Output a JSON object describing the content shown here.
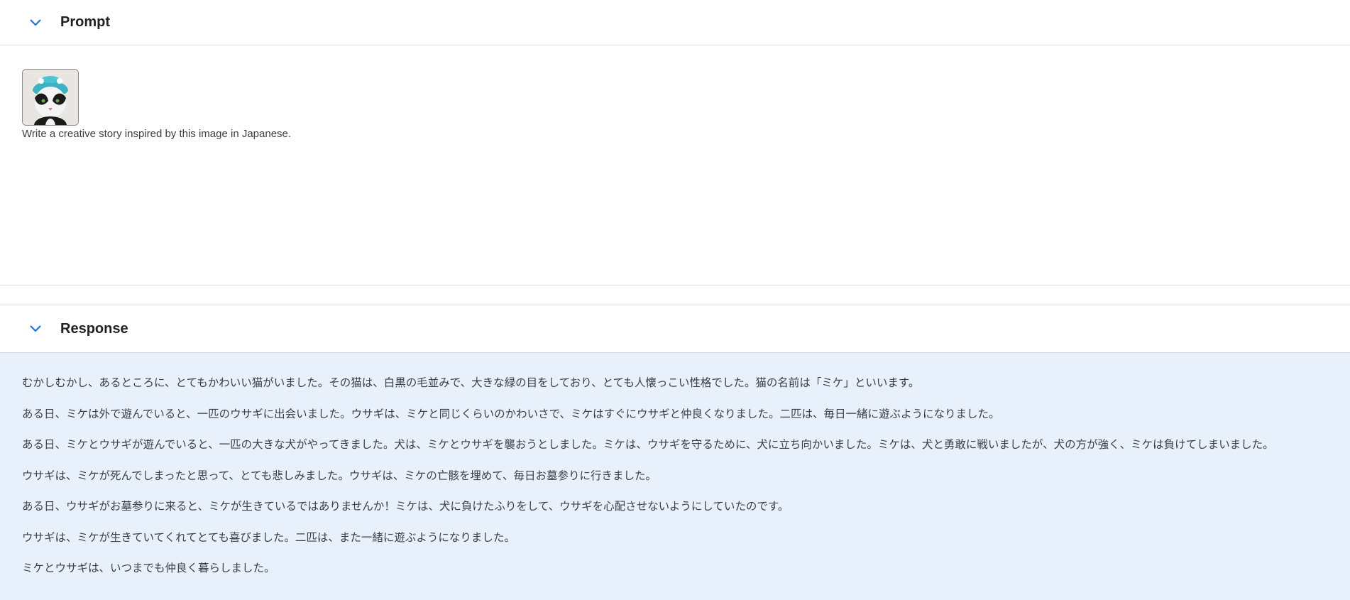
{
  "prompt_panel": {
    "title": "Prompt",
    "text": "Write a creative story inspired by this image in Japanese."
  },
  "response_panel": {
    "title": "Response",
    "paragraphs": [
      "むかしむかし、あるところに、とてもかわいい猫がいました。その猫は、白黒の毛並みで、大きな緑の目をしており、とても人懐っこい性格でした。猫の名前は「ミケ」といいます。",
      "ある日、ミケは外で遊んでいると、一匹のウサギに出会いました。ウサギは、ミケと同じくらいのかわいさで、ミケはすぐにウサギと仲良くなりました。二匹は、毎日一緒に遊ぶようになりました。",
      "ある日、ミケとウサギが遊んでいると、一匹の大きな犬がやってきました。犬は、ミケとウサギを襲おうとしました。ミケは、ウサギを守るために、犬に立ち向かいました。ミケは、犬と勇敢に戦いましたが、犬の方が強く、ミケは負けてしまいました。",
      "ウサギは、ミケが死んでしまったと思って、とても悲しみました。ウサギは、ミケの亡骸を埋めて、毎日お墓参りに行きました。",
      "ある日、ウサギがお墓参りに来ると、ミケが生きているではありませんか！ミケは、犬に負けたふりをして、ウサギを心配させないようにしていたのです。",
      "ウサギは、ミケが生きていてくれてとても喜びました。二匹は、また一緒に遊ぶようになりました。",
      "ミケとウサギは、いつまでも仲良く暮らしました。"
    ]
  },
  "colors": {
    "chevron": "#1a73e8",
    "response_bg": "#e8f0fb",
    "divider": "#dadce0"
  }
}
